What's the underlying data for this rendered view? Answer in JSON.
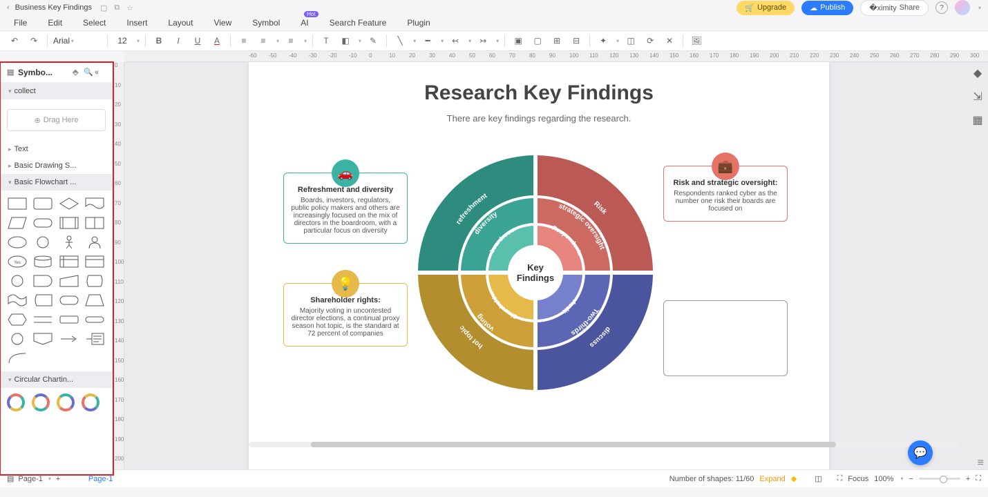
{
  "titlebar": {
    "doc": "Business Key Findings",
    "upgrade": "Upgrade",
    "publish": "Publish",
    "share": "Share"
  },
  "menu": {
    "file": "File",
    "edit": "Edit",
    "select": "Select",
    "insert": "Insert",
    "layout": "Layout",
    "view": "View",
    "symbol": "Symbol",
    "ai": "AI",
    "search": "Search Feature",
    "plugin": "Plugin"
  },
  "toolbar": {
    "font": "Arial",
    "fontsize": "12"
  },
  "panel": {
    "title": "Symbo...",
    "collect": "collect",
    "drag": "Drag Here",
    "text": "Text",
    "basic_draw": "Basic Drawing S...",
    "basic_flow": "Basic Flowchart ...",
    "circular": "Circular Chartin..."
  },
  "canvas": {
    "title": "Research Key Findings",
    "subtitle": "There are key findings regarding the research.",
    "center": "Key Findings"
  },
  "cards": {
    "teal_title": "Refreshment and diversity",
    "teal_body": "Boards, investors, regulators, public policy makers and others are increasingly focused on the mix of directors in the boardroom, with a particular focus on diversity",
    "red_title": "Risk and strategic oversight:",
    "red_body": "Respondents ranked cyber as the number one risk their boards are focused on",
    "yellow_title": "Shareholder rights:",
    "yellow_body": "Majority voting in uncontested director elections, a continual proxy season hot topic, is the standard at 72 percent of companies"
  },
  "wheel": {
    "q1": {
      "outer": "Risk",
      "mid": "strategic oversight",
      "inner": "Respondents"
    },
    "q2": {
      "outer": "discuss",
      "mid": "Two-thirds",
      "inner": "Audit"
    },
    "q3": {
      "outer": "hot topic",
      "mid": "voting",
      "inner": "Shareholder"
    },
    "q4": {
      "outer": "refreshment",
      "mid": "diversity",
      "inner": "boardroom"
    }
  },
  "bottom": {
    "page_sel": "Page-1",
    "page_tab": "Page-1",
    "shapes": "Number of shapes: 11/60",
    "expand": "Expand",
    "focus": "Focus",
    "zoom": "100%"
  }
}
